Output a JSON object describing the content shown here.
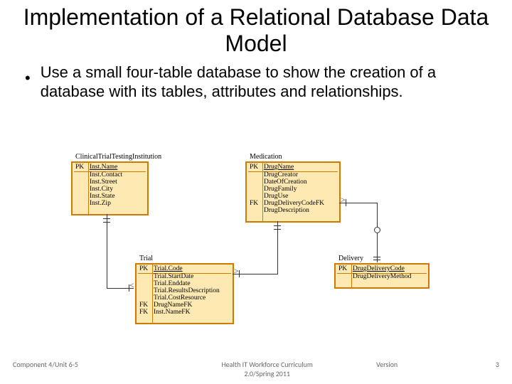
{
  "title": "Implementation of a Relational Database Data Model",
  "bullet": "Use a small four-table database to show the creation of a database with its tables, attributes and relationships.",
  "entities": {
    "institution": {
      "title": "ClinicalTrialTestingInstitution",
      "rows": [
        {
          "pk": "PK",
          "name": "Inst.Name",
          "underline": true
        },
        {
          "pk": "",
          "name": "Inst.Contact"
        },
        {
          "pk": "",
          "name": "Inst.Street"
        },
        {
          "pk": "",
          "name": "Inst.City"
        },
        {
          "pk": "",
          "name": "Inst.State"
        },
        {
          "pk": "",
          "name": "Inst.Zip"
        }
      ]
    },
    "medication": {
      "title": "Medication",
      "rows": [
        {
          "pk": "PK",
          "name": "DrugName",
          "underline": true
        },
        {
          "pk": "",
          "name": "DrugCreator"
        },
        {
          "pk": "",
          "name": "DateOfCreation"
        },
        {
          "pk": "",
          "name": "DrugFamily"
        },
        {
          "pk": "",
          "name": "DrugUse"
        },
        {
          "pk": "FK",
          "name": "DrugDeliveryCodeFK"
        },
        {
          "pk": "",
          "name": "DrugDescription"
        }
      ]
    },
    "trial": {
      "title": "Trial",
      "rows": [
        {
          "pk": "PK",
          "name": "Trial.Code",
          "underline": true
        },
        {
          "pk": "",
          "name": "Trial.StartDate"
        },
        {
          "pk": "",
          "name": "Trial.Enddate"
        },
        {
          "pk": "",
          "name": "Trial.ResultsDescription"
        },
        {
          "pk": "",
          "name": "Trial.CostResource"
        },
        {
          "pk": "FK",
          "name": "DrugNameFK"
        },
        {
          "pk": "FK",
          "name": "Inst.NameFK"
        }
      ]
    },
    "delivery": {
      "title": "Delivery",
      "rows": [
        {
          "pk": "PK",
          "name": "DrugDeliveryCode",
          "underline": true
        },
        {
          "pk": "",
          "name": "DrugDeliveryMethod"
        }
      ]
    }
  },
  "footer": {
    "left": "Component 4/Unit 6-5",
    "center_l1": "Health IT Workforce Curriculum",
    "center_l2": "2.0/Spring 2011",
    "right1": "Version",
    "right2": "3"
  }
}
